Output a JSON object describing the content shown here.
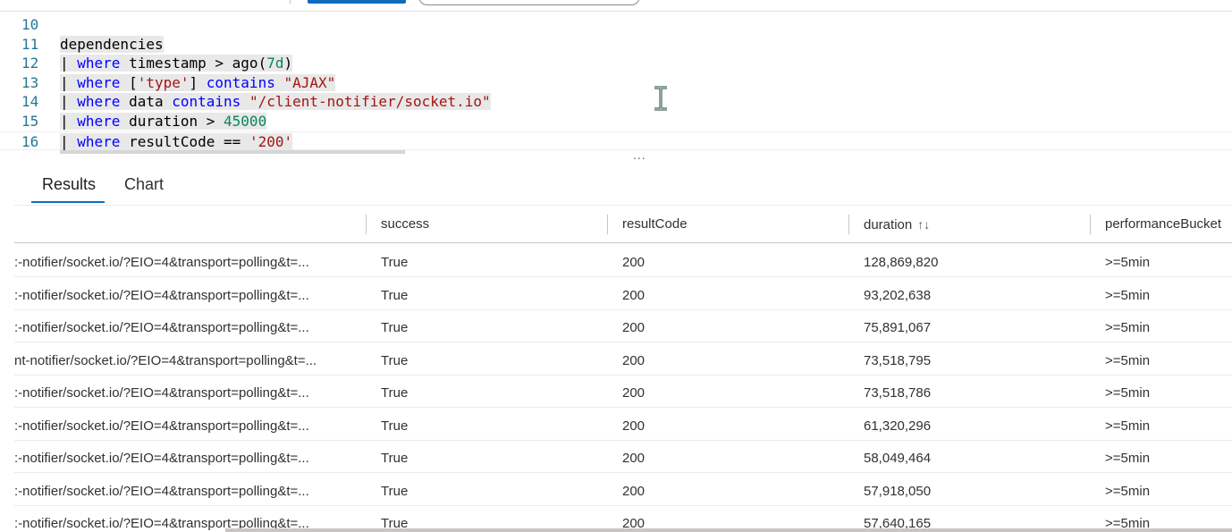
{
  "editor": {
    "lines": [
      {
        "n": "10",
        "tokens": []
      },
      {
        "n": "11",
        "tokens": [
          {
            "t": "dependencies",
            "c": "hl"
          }
        ]
      },
      {
        "n": "12",
        "tokens": [
          {
            "t": "| ",
            "c": "hl"
          },
          {
            "t": "where",
            "c": "kw hl"
          },
          {
            "t": " timestamp > ago(",
            "c": "hl"
          },
          {
            "t": "7d",
            "c": "num hl"
          },
          {
            "t": ")",
            "c": "hl"
          }
        ]
      },
      {
        "n": "13",
        "tokens": [
          {
            "t": "| ",
            "c": "hl"
          },
          {
            "t": "where",
            "c": "kw hl"
          },
          {
            "t": " [",
            "c": "hl"
          },
          {
            "t": "'type'",
            "c": "str hl"
          },
          {
            "t": "] ",
            "c": "hl"
          },
          {
            "t": "contains",
            "c": "kw hl"
          },
          {
            "t": " ",
            "c": "hl"
          },
          {
            "t": "\"AJAX\"",
            "c": "str hl"
          }
        ]
      },
      {
        "n": "14",
        "tokens": [
          {
            "t": "| ",
            "c": "hl"
          },
          {
            "t": "where",
            "c": "kw hl"
          },
          {
            "t": " data ",
            "c": "hl"
          },
          {
            "t": "contains",
            "c": "kw hl"
          },
          {
            "t": " ",
            "c": "hl"
          },
          {
            "t": "\"/client-notifier/socket.io\"",
            "c": "str hl"
          }
        ]
      },
      {
        "n": "15",
        "tokens": [
          {
            "t": "| ",
            "c": "hl"
          },
          {
            "t": "where",
            "c": "kw hl"
          },
          {
            "t": " duration > ",
            "c": "hl"
          },
          {
            "t": "45000",
            "c": "num hl"
          }
        ]
      },
      {
        "n": "16",
        "tokens": [
          {
            "t": "| ",
            "c": "hl"
          },
          {
            "t": "where",
            "c": "kw hl"
          },
          {
            "t": " resultCode == ",
            "c": "hl"
          },
          {
            "t": "'200'",
            "c": "str hl"
          }
        ]
      }
    ]
  },
  "resize_handle": "...",
  "tabs": [
    {
      "label": "Results",
      "active": true
    },
    {
      "label": "Chart",
      "active": false
    }
  ],
  "table": {
    "columns": [
      "success",
      "resultCode",
      "duration",
      "performanceBucket"
    ],
    "sort_icon": "↑↓",
    "rows": [
      {
        "data": ":-notifier/socket.io/?EIO=4&transport=polling&t=...",
        "success": "True",
        "resultCode": "200",
        "duration": "128,869,820",
        "bucket": ">=5min"
      },
      {
        "data": ":-notifier/socket.io/?EIO=4&transport=polling&t=...",
        "success": "True",
        "resultCode": "200",
        "duration": "93,202,638",
        "bucket": ">=5min"
      },
      {
        "data": ":-notifier/socket.io/?EIO=4&transport=polling&t=...",
        "success": "True",
        "resultCode": "200",
        "duration": "75,891,067",
        "bucket": ">=5min"
      },
      {
        "data": "nt-notifier/socket.io/?EIO=4&transport=polling&t=...",
        "success": "True",
        "resultCode": "200",
        "duration": "73,518,795",
        "bucket": ">=5min"
      },
      {
        "data": ":-notifier/socket.io/?EIO=4&transport=polling&t=...",
        "success": "True",
        "resultCode": "200",
        "duration": "73,518,786",
        "bucket": ">=5min"
      },
      {
        "data": ":-notifier/socket.io/?EIO=4&transport=polling&t=...",
        "success": "True",
        "resultCode": "200",
        "duration": "61,320,296",
        "bucket": ">=5min"
      },
      {
        "data": ":-notifier/socket.io/?EIO=4&transport=polling&t=...",
        "success": "True",
        "resultCode": "200",
        "duration": "58,049,464",
        "bucket": ">=5min"
      },
      {
        "data": ":-notifier/socket.io/?EIO=4&transport=polling&t=...",
        "success": "True",
        "resultCode": "200",
        "duration": "57,918,050",
        "bucket": ">=5min"
      },
      {
        "data": ":-notifier/socket.io/?EIO=4&transport=polling&t=...",
        "success": "True",
        "resultCode": "200",
        "duration": "57,640,165",
        "bucket": ">=5min"
      }
    ]
  },
  "colors": {
    "accent": "#0f6cbd",
    "keyword": "#0000ff",
    "string": "#a31515",
    "number": "#098658",
    "line_number": "#237893"
  }
}
